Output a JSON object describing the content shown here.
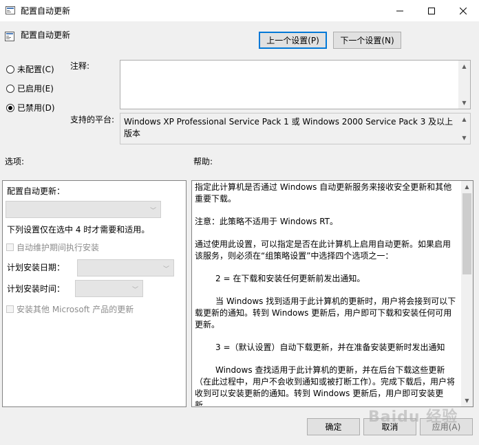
{
  "window": {
    "title": "配置自动更新",
    "buttons": {
      "minimize": "—",
      "maximize": "☐",
      "close": "✕"
    }
  },
  "header": {
    "title": "配置自动更新",
    "prev_button": "上一个设置(P)",
    "next_button": "下一个设置(N)"
  },
  "state": {
    "options": [
      "未配置(C)",
      "已启用(E)",
      "已禁用(D)"
    ],
    "selected": "已禁用(D)"
  },
  "comment": {
    "label": "注释:",
    "value": ""
  },
  "platform": {
    "label": "支持的平台:",
    "value": "Windows XP Professional Service Pack 1 或 Windows 2000 Service Pack 3 及以上版本"
  },
  "options_panel": {
    "label": "选项:",
    "configure_label": "配置自动更新：",
    "configure_value": "",
    "note": "下列设置仅在选中 4 时才需要和适用。",
    "maintenance_checkbox": "自动维护期间执行安装",
    "schedule_day_label": "计划安装日期：",
    "schedule_day_value": "",
    "schedule_time_label": "计划安装时间：",
    "schedule_time_value": "",
    "other_products_checkbox": "安装其他 Microsoft 产品的更新"
  },
  "help_panel": {
    "label": "帮助:",
    "paragraphs": [
      "指定此计算机是否通过 Windows 自动更新服务来接收安全更新和其他重要下载。",
      "注意：此策略不适用于 Windows RT。",
      "通过使用此设置，可以指定是否在此计算机上启用自动更新。如果启用该服务，则必须在“组策略设置”中选择四个选项之一：",
      "2 = 在下载和安装任何更新前发出通知。",
      "当 Windows 找到适用于此计算机的更新时，用户将会接到可以下载更新的通知。转到 Windows 更新后，用户即可下载和安装任何可用更新。",
      "3 =（默认设置）自动下载更新，并在准备安装更新时发出通知",
      "Windows 查找适用于此计算机的更新，并在后台下载这些更新（在此过程中，用户不会收到通知或被打断工作）。完成下载后，用户将收到可以安装更新的通知。转到 Windows 更新后，用户即可安装更新。"
    ]
  },
  "footer": {
    "ok": "确定",
    "cancel": "取消",
    "apply": "应用(A)"
  },
  "watermark": "Baidu 经验"
}
